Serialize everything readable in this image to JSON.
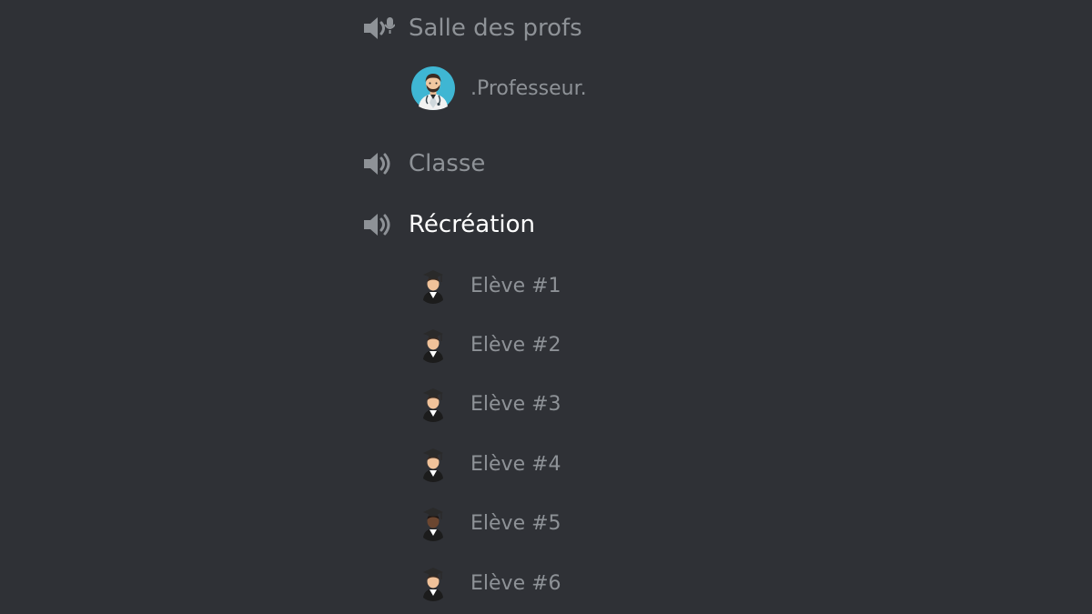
{
  "voice_channels": [
    {
      "label": "Salle des profs",
      "icon": "speaker-icon",
      "active": false,
      "members": [
        {
          "name": ".Professeur.",
          "avatar": "doctor-avatar"
        }
      ]
    },
    {
      "label": "Classe",
      "icon": "speaker-icon",
      "active": false,
      "members": []
    },
    {
      "label": "Récréation",
      "icon": "speaker-icon",
      "active": true,
      "members": [
        {
          "name": "Elève #1",
          "avatar": "graduate-avatar"
        },
        {
          "name": "Elève #2",
          "avatar": "graduate-avatar"
        },
        {
          "name": "Elève #3",
          "avatar": "graduate-avatar"
        },
        {
          "name": "Elève #4",
          "avatar": "graduate-avatar"
        },
        {
          "name": "Elève #5",
          "avatar": "graduate-avatar-dark"
        },
        {
          "name": "Elève #6",
          "avatar": "graduate-avatar"
        }
      ]
    }
  ],
  "colors": {
    "background": "#2f3136",
    "muted_text": "#8e9297",
    "active_text": "#ffffff",
    "doctor_avatar_bg": "#3fb6d3"
  }
}
